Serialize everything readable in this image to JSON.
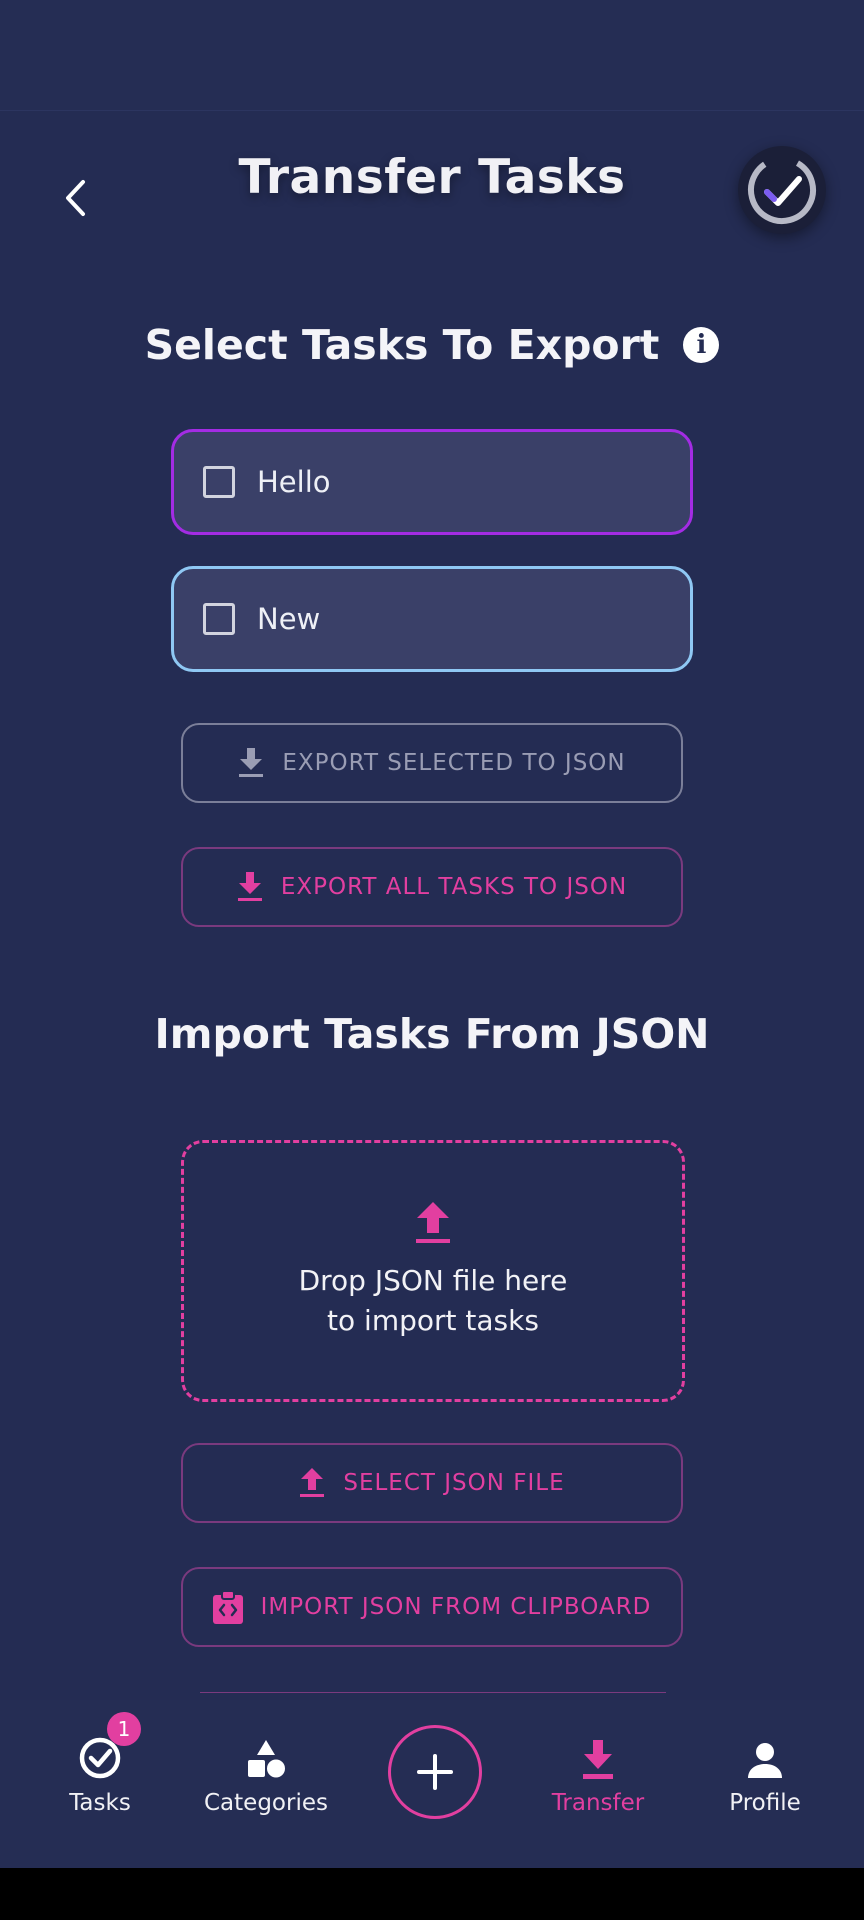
{
  "header": {
    "title": "Transfer Tasks"
  },
  "export_section": {
    "title": "Select Tasks To Export",
    "tasks": [
      {
        "label": "Hello"
      },
      {
        "label": "New"
      }
    ],
    "export_selected_label": "EXPORT SELECTED TO JSON",
    "export_all_label": "EXPORT ALL TASKS TO JSON"
  },
  "import_section": {
    "title": "Import Tasks From JSON",
    "drop_line1": "Drop JSON file here",
    "drop_line2": "to import tasks",
    "select_file_label": "SELECT JSON FILE",
    "clipboard_label": "IMPORT JSON FROM CLIPBOARD"
  },
  "navbar": {
    "items": [
      {
        "label": "Tasks",
        "icon": "check-circle-icon",
        "badge": "1"
      },
      {
        "label": "Categories",
        "icon": "shapes-icon"
      },
      {
        "label": "Transfer",
        "icon": "download-icon",
        "active": true
      },
      {
        "label": "Profile",
        "icon": "person-icon"
      }
    ],
    "add_icon": "plus-icon"
  },
  "colors": {
    "background": "#242c53",
    "accent": "#e23fa0",
    "purple": "#a32ce4",
    "light_blue": "#8fc8f4"
  }
}
